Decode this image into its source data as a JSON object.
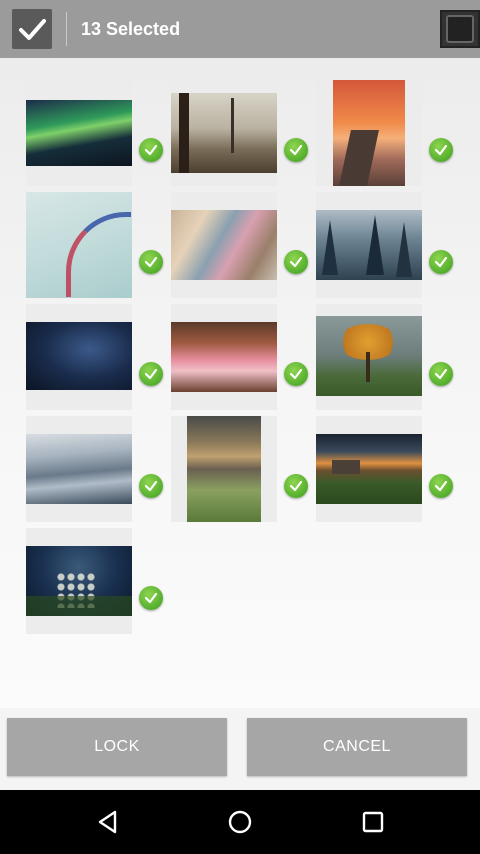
{
  "header": {
    "title": "13 Selected"
  },
  "actions": {
    "lock_label": "LOCK",
    "cancel_label": "CANCEL"
  },
  "photos": [
    {
      "id": 1,
      "subject": "aurora",
      "selected": true
    },
    {
      "id": 2,
      "subject": "misty-trees",
      "selected": true
    },
    {
      "id": 3,
      "subject": "sunset-pier",
      "selected": true
    },
    {
      "id": 4,
      "subject": "airshow",
      "selected": true
    },
    {
      "id": 5,
      "subject": "abstract-blur",
      "selected": true
    },
    {
      "id": 6,
      "subject": "foggy-forest",
      "selected": true
    },
    {
      "id": 7,
      "subject": "milky-way",
      "selected": true
    },
    {
      "id": 8,
      "subject": "waterfall",
      "selected": true
    },
    {
      "id": 9,
      "subject": "autumn-tree",
      "selected": true
    },
    {
      "id": 10,
      "subject": "sea-waves",
      "selected": true
    },
    {
      "id": 11,
      "subject": "lake-reeds",
      "selected": true
    },
    {
      "id": 12,
      "subject": "ruins-sunset",
      "selected": true
    },
    {
      "id": 13,
      "subject": "wildflowers",
      "selected": true
    }
  ],
  "colors": {
    "topbar": "#9b9b9b",
    "badge": "#5fbf2f",
    "button": "#a6a6a6",
    "navbar": "#000000"
  }
}
